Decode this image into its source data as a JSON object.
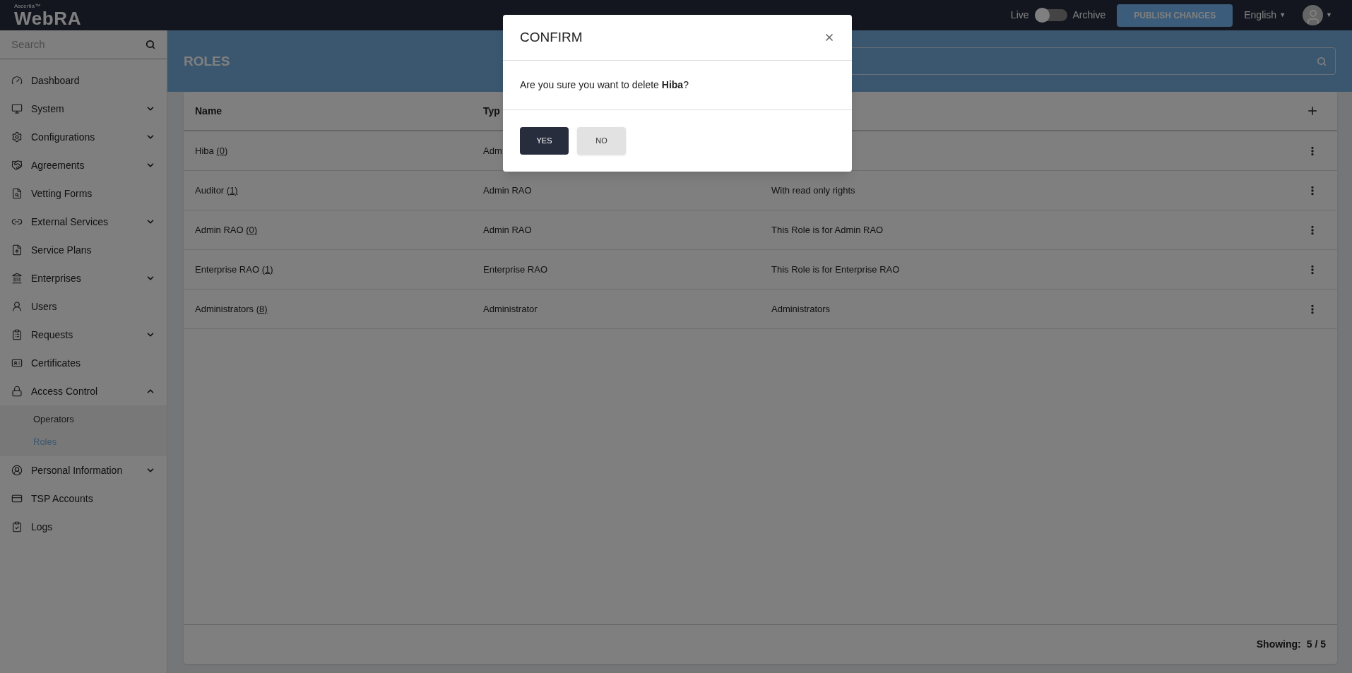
{
  "header": {
    "brand_small": "Ascertia™",
    "brand": "WebRA",
    "toggle": {
      "left_label": "Live",
      "right_label": "Archive",
      "on": false
    },
    "publish_button": "PUBLISH CHANGES",
    "language": "English",
    "language_caret": "▼",
    "avatar_caret": "▼"
  },
  "sidebar": {
    "search": {
      "placeholder": "Search"
    },
    "items": [
      {
        "label": "Dashboard"
      },
      {
        "label": "System",
        "expanded": false
      },
      {
        "label": "Configurations",
        "expanded": false
      },
      {
        "label": "Agreements",
        "expanded": false
      },
      {
        "label": "Vetting Forms"
      },
      {
        "label": "External Services",
        "expanded": false
      },
      {
        "label": "Service Plans"
      },
      {
        "label": "Enterprises",
        "expanded": false
      },
      {
        "label": "Users"
      },
      {
        "label": "Requests",
        "expanded": false
      },
      {
        "label": "Certificates"
      },
      {
        "label": "Access Control",
        "expanded": true,
        "children": [
          {
            "label": "Operators",
            "selected": false
          },
          {
            "label": "Roles",
            "selected": true
          }
        ]
      },
      {
        "label": "Personal Information",
        "expanded": false
      },
      {
        "label": "TSP Accounts"
      },
      {
        "label": "Logs"
      }
    ]
  },
  "page": {
    "title": "ROLES"
  },
  "table": {
    "columns": [
      "Name",
      "Typ"
    ],
    "rows": [
      {
        "name": "Hiba (0)",
        "type": "Adm"
      },
      {
        "name": "Auditor (1)",
        "type": "Admin RAO",
        "description": "With read only rights"
      },
      {
        "name": "Admin RAO (0)",
        "type": "Admin RAO",
        "description": "This Role is for Admin RAO"
      },
      {
        "name": "Enterprise RAO (1)",
        "type": "Enterprise RAO",
        "description": "This Role is for Enterprise RAO"
      },
      {
        "name": "Administrators (8)",
        "type": "Administrator",
        "description": "Administrators"
      }
    ],
    "footer_label": "Showing:",
    "footer_value": "5 / 5"
  },
  "dialog": {
    "title": "CONFIRM",
    "message": "Are you sure you want to delete **Hiba**?",
    "buttons": [
      {
        "label": "YES",
        "kind": "primary"
      },
      {
        "label": "NO",
        "kind": "secondary"
      }
    ]
  }
}
